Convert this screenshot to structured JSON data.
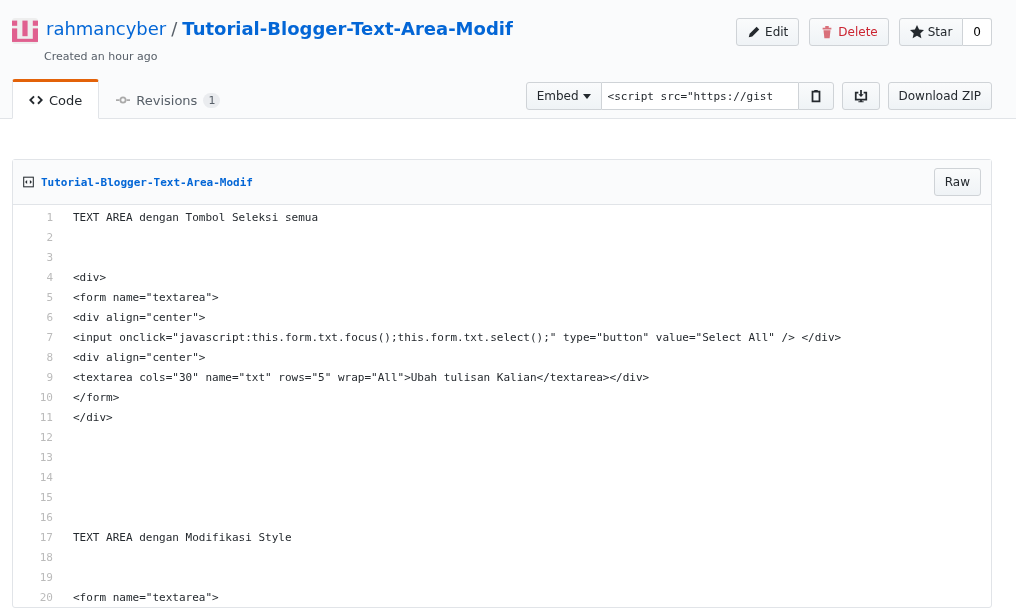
{
  "header": {
    "owner": "rahmancyber",
    "separator": "/",
    "gist_name": "Tutorial-Blogger-Text-Area-Modif",
    "created": "Created an hour ago",
    "actions": [
      {
        "kind": "edit",
        "label": "Edit"
      },
      {
        "kind": "delete",
        "label": "Delete"
      }
    ],
    "star": {
      "label": "Star",
      "count": "0"
    }
  },
  "tabs": [
    {
      "kind": "code",
      "label": "Code",
      "selected": true
    },
    {
      "kind": "revisions",
      "label": "Revisions",
      "count": "1",
      "selected": false
    }
  ],
  "embed": {
    "label": "Embed",
    "value": "<script src=\"https://gist"
  },
  "download": {
    "label": "Download ZIP"
  },
  "file": {
    "name": "Tutorial-Blogger-Text-Area-Modif",
    "raw": "Raw",
    "lines": [
      {
        "n": "1",
        "text": "TEXT AREA dengan Tombol Seleksi semua"
      },
      {
        "n": "2"
      },
      {
        "n": "3"
      },
      {
        "n": "4",
        "text": "<div>"
      },
      {
        "n": "5",
        "text": "<form name=\"textarea\">"
      },
      {
        "n": "6",
        "text": "<div align=\"center\">"
      },
      {
        "n": "7",
        "text": "<input onclick=\"javascript:this.form.txt.focus();this.form.txt.select();\" type=\"button\" value=\"Select All\" /> </div>"
      },
      {
        "n": "8",
        "text": "<div align=\"center\">"
      },
      {
        "n": "9",
        "text": "<textarea cols=\"30\" name=\"txt\" rows=\"5\" wrap=\"All\">Ubah tulisan Kalian</textarea></div>"
      },
      {
        "n": "10",
        "text": "</form>"
      },
      {
        "n": "11",
        "text": "</div>"
      },
      {
        "n": "12"
      },
      {
        "n": "13"
      },
      {
        "n": "14"
      },
      {
        "n": "15"
      },
      {
        "n": "16"
      },
      {
        "n": "17",
        "text": "TEXT AREA dengan Modifikasi Style"
      },
      {
        "n": "18"
      },
      {
        "n": "19"
      },
      {
        "n": "20",
        "text": "<form name=\"textarea\">"
      }
    ]
  }
}
